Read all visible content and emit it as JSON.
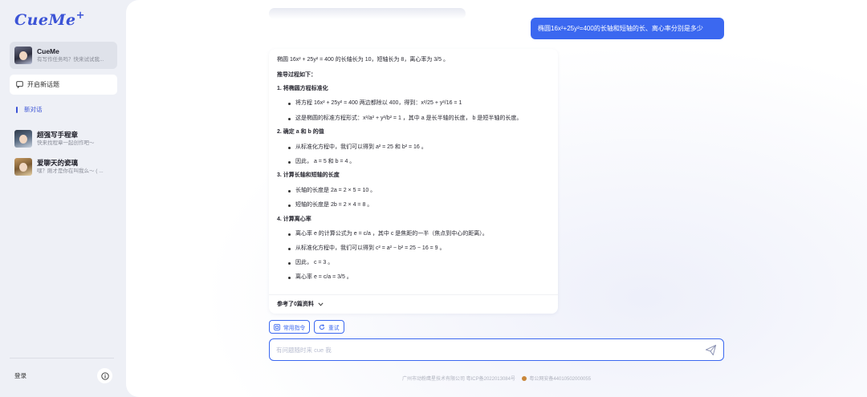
{
  "app": {
    "logo": "CueMe",
    "logo_plus": "+"
  },
  "sidebar": {
    "active_chat": {
      "title": "CueMe",
      "subtitle": "有写作任务吗？快来试试我..."
    },
    "new_chat_label": "开启新话题",
    "section_label": "新对话",
    "chats": [
      {
        "title": "超强写手程章",
        "subtitle": "快来找程章一起创作吧～"
      },
      {
        "title": "爱聊天的瓷璃",
        "subtitle": "嘿？刚才是你在叫我么～ ( ..."
      }
    ],
    "login_label": "登录"
  },
  "conversation": {
    "user_message": "椭圆16x²+25y²=400的长轴和短轴的长、离心率分别是多少",
    "answer": {
      "summary": "椭圆 16x² + 25y² = 400 的长轴长为 10，短轴长为 8，离心率为 3/5 。",
      "derivation_label": "推导过程如下：",
      "steps": [
        {
          "heading": "1. 将椭圆方程标准化",
          "bullets": [
            "将方程 16x² + 25y² = 400 两边都除以 400，得到：x²/25 + y²/16 = 1",
            "这是椭圆的标准方程形式：x²/a² + y²/b² = 1 ，其中 a 是长半轴的长度， b 是短半轴的长度。"
          ]
        },
        {
          "heading": "2. 确定 a 和 b 的值",
          "bullets": [
            "从标准化方程中，我们可以得到 a² = 25 和 b² = 16 。",
            "因此， a = 5 和 b = 4 。"
          ]
        },
        {
          "heading": "3. 计算长轴和短轴的长度",
          "bullets": [
            "长轴的长度是 2a = 2 × 5 = 10 。",
            "短轴的长度是 2b = 2 × 4 = 8 。"
          ]
        },
        {
          "heading": "4. 计算离心率",
          "bullets": [
            "离心率 e 的计算公式为 e = c/a ，其中 c 是焦距的一半（焦点到中心的距离）。",
            "从标准化方程中，我们可以得到 c² = a² − b² = 25 − 16 = 9 。",
            "因此， c = 3 。",
            "离心率 e = c/a = 3/5 。"
          ]
        }
      ],
      "references_label": "参考了0篇资料"
    }
  },
  "actions": {
    "commands_label": "常用指令",
    "retry_label": "重试"
  },
  "composer": {
    "placeholder": "有问题随时来 cue 我"
  },
  "footer": {
    "icp": "广州市动粉鹰星技术有限公司 粤ICP备2022013084号",
    "police": "粤公网安备44010502000055"
  },
  "colors": {
    "accent": "#3b68f0",
    "logo": "#3b53d6",
    "sidebar_bg": "#eef0f6"
  }
}
